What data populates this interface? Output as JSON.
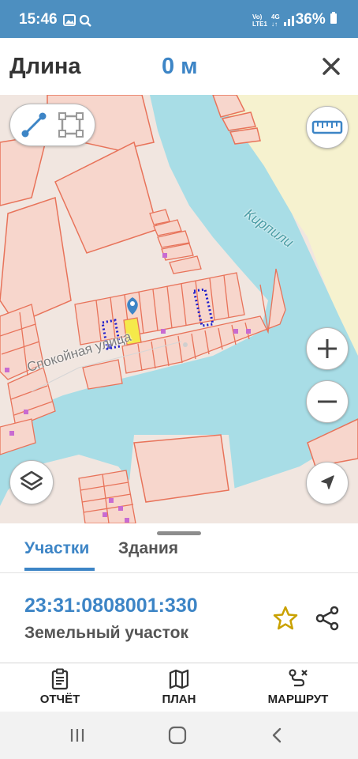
{
  "status_bar": {
    "time": "15:46",
    "network": "Vo) LTE1 4G",
    "battery": "36%"
  },
  "toolbar": {
    "title": "Длина",
    "value": "0 м",
    "close_icon": "close-icon"
  },
  "map": {
    "street_label": "Спокойная улица",
    "river_label": "Кирпили",
    "colors": {
      "water": "#a8dde6",
      "land": "#f1e6e0",
      "field": "#f6f2cf",
      "parcel_line": "#e8735a",
      "parcel_fill": "#f7d6cc",
      "building": "#c86bd1",
      "selected_parcel": "#f5e94a",
      "route_dots": "#1c1ccc",
      "accent": "#3d85c6"
    },
    "controls": {
      "mode_line_icon": "line-measure-icon",
      "mode_area_icon": "area-measure-icon",
      "ruler_icon": "ruler-icon",
      "zoom_in_icon": "plus-icon",
      "zoom_out_icon": "minus-icon",
      "layers_icon": "layers-icon",
      "locate_icon": "navigation-arrow-icon"
    }
  },
  "sheet": {
    "tabs": [
      {
        "label": "Участки",
        "active": true
      },
      {
        "label": "Здания",
        "active": false
      }
    ],
    "parcel_id": "23:31:0808001:330",
    "parcel_type": "Земельный участок"
  },
  "bottom_nav": {
    "items": [
      {
        "label": "ОТЧЁТ",
        "icon": "report-clipboard-icon"
      },
      {
        "label": "ПЛАН",
        "icon": "map-plan-icon"
      },
      {
        "label": "МАРШРУТ",
        "icon": "route-icon"
      }
    ]
  }
}
